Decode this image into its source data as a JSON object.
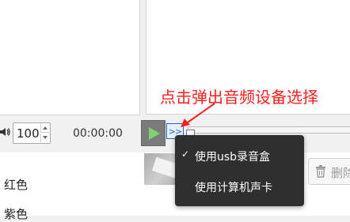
{
  "controls": {
    "volume_value": "100",
    "time": "00:00:00",
    "device_toggle_label": ">>"
  },
  "annotation": {
    "text": "点击弹出音频设备选择",
    "color": "#ff2020"
  },
  "device_menu": {
    "items": [
      {
        "label": "使用usb录音盒",
        "checked": true,
        "check_mark": "✓"
      },
      {
        "label": "使用计算机声卡",
        "checked": false,
        "check_mark": ""
      }
    ]
  },
  "color_list": {
    "items": [
      "红色",
      "紫色"
    ]
  },
  "delete_button": {
    "label": "删除"
  },
  "icons": {
    "volume": "speaker-icon",
    "play": "play-icon",
    "delete": "trash-icon"
  },
  "colors": {
    "play_button_bg": "#7b7b7b",
    "play_icon": "#7fd26d",
    "menu_bg": "#2f2f2f",
    "toggle_border": "#1f63d3"
  }
}
